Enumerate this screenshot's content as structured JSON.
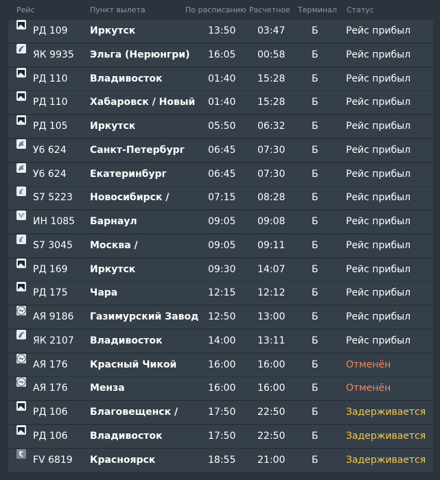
{
  "header": {
    "flight": "Рейс",
    "origin": "Пункт вылета",
    "scheduled": "По расписанию",
    "estimated": "Расчетное",
    "terminal": "Терминал",
    "status": "Статус"
  },
  "colors": {
    "background": "#2b343c",
    "row": "#343f49",
    "header_text": "#8f9aa4",
    "arrived": "#ffffff",
    "cancelled": "#f08a69",
    "delayed": "#f2c94c"
  },
  "flights": [
    {
      "logo": "angara-logo",
      "flight": "РД 109",
      "city": "Иркутск",
      "scheduled": "13:50",
      "estimated": "03:47",
      "terminal": "Б",
      "status": "Рейс прибыл",
      "status_type": "arrived"
    },
    {
      "logo": "yakutia-logo",
      "flight": "ЯК 9935",
      "city": "Эльга (Нерюнгри)",
      "scheduled": "16:05",
      "estimated": "00:58",
      "terminal": "Б",
      "status": "Рейс прибыл",
      "status_type": "arrived"
    },
    {
      "logo": "angara-logo",
      "flight": "РД 110",
      "city": "Владивосток",
      "scheduled": "01:40",
      "estimated": "15:28",
      "terminal": "Б",
      "status": "Рейс прибыл",
      "status_type": "arrived"
    },
    {
      "logo": "angara-logo",
      "flight": "РД 110",
      "city": "Хабаровск / Новый",
      "scheduled": "01:40",
      "estimated": "15:28",
      "terminal": "Б",
      "status": "Рейс прибыл",
      "status_type": "arrived"
    },
    {
      "logo": "angara-logo",
      "flight": "РД 105",
      "city": "Иркутск",
      "scheduled": "05:50",
      "estimated": "06:32",
      "terminal": "Б",
      "status": "Рейс прибыл",
      "status_type": "arrived"
    },
    {
      "logo": "ural-logo",
      "flight": "У6 624",
      "city": "Санкт-Петербург",
      "scheduled": "06:45",
      "estimated": "07:30",
      "terminal": "Б",
      "status": "Рейс прибыл",
      "status_type": "arrived"
    },
    {
      "logo": "ural-logo",
      "flight": "У6 624",
      "city": "Екатеринбург",
      "scheduled": "06:45",
      "estimated": "07:30",
      "terminal": "Б",
      "status": "Рейс прибыл",
      "status_type": "arrived"
    },
    {
      "logo": "s7-logo",
      "flight": "S7 5223",
      "city": "Новосибирск /",
      "scheduled": "07:15",
      "estimated": "08:28",
      "terminal": "Б",
      "status": "Рейс прибыл",
      "status_type": "arrived"
    },
    {
      "logo": "irkut-logo",
      "flight": "ИН 1085",
      "city": "Барнаул",
      "scheduled": "09:05",
      "estimated": "09:08",
      "terminal": "Б",
      "status": "Рейс прибыл",
      "status_type": "arrived"
    },
    {
      "logo": "s7-logo",
      "flight": "S7 3045",
      "city": "Москва /",
      "scheduled": "09:05",
      "estimated": "09:11",
      "terminal": "Б",
      "status": "Рейс прибыл",
      "status_type": "arrived"
    },
    {
      "logo": "angara-logo",
      "flight": "РД 169",
      "city": "Иркутск",
      "scheduled": "09:30",
      "estimated": "14:07",
      "terminal": "Б",
      "status": "Рейс прибыл",
      "status_type": "arrived"
    },
    {
      "logo": "angara-logo",
      "flight": "РД 175",
      "city": "Чара",
      "scheduled": "12:15",
      "estimated": "12:12",
      "terminal": "Б",
      "status": "Рейс прибыл",
      "status_type": "arrived"
    },
    {
      "logo": "aeroflot-logo",
      "flight": "АЯ 9186",
      "city": "Газимурский Завод",
      "scheduled": "12:50",
      "estimated": "13:00",
      "terminal": "Б",
      "status": "Рейс прибыл",
      "status_type": "arrived"
    },
    {
      "logo": "yakutia-logo",
      "flight": "ЯК 2107",
      "city": "Владивосток",
      "scheduled": "14:00",
      "estimated": "13:11",
      "terminal": "Б",
      "status": "Рейс прибыл",
      "status_type": "arrived"
    },
    {
      "logo": "aeroflot-logo",
      "flight": "АЯ 176",
      "city": "Красный Чикой",
      "scheduled": "16:00",
      "estimated": "16:00",
      "terminal": "Б",
      "status": "Отменён",
      "status_type": "cancelled"
    },
    {
      "logo": "aeroflot-logo",
      "flight": "АЯ 176",
      "city": "Менза",
      "scheduled": "16:00",
      "estimated": "16:00",
      "terminal": "Б",
      "status": "Отменён",
      "status_type": "cancelled"
    },
    {
      "logo": "angara-logo",
      "flight": "РД 106",
      "city": "Благовещенск /",
      "scheduled": "17:50",
      "estimated": "22:50",
      "terminal": "Б",
      "status": "Задерживается",
      "status_type": "delayed"
    },
    {
      "logo": "angara-logo",
      "flight": "РД 106",
      "city": "Владивосток",
      "scheduled": "17:50",
      "estimated": "22:50",
      "terminal": "Б",
      "status": "Задерживается",
      "status_type": "delayed"
    },
    {
      "logo": "red-wings-logo",
      "flight": "FV 6819",
      "city": "Красноярск",
      "scheduled": "18:55",
      "estimated": "21:00",
      "terminal": "Б",
      "status": "Задерживается",
      "status_type": "delayed"
    }
  ]
}
